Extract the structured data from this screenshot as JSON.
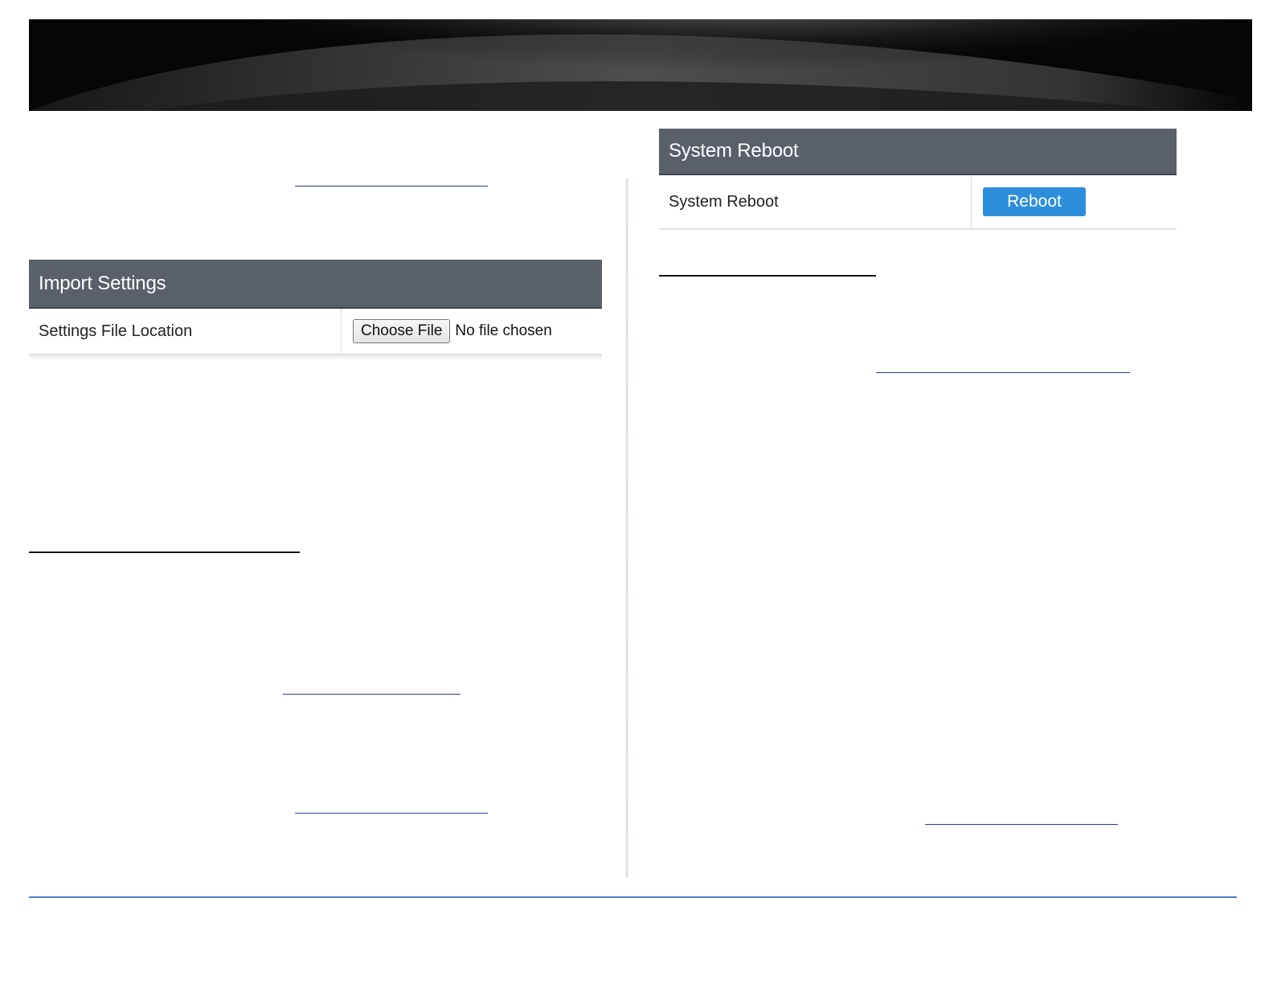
{
  "import_settings": {
    "title": "Import Settings",
    "row_label": "Settings File Location",
    "choose_file_label": "Choose File",
    "file_status": "No file chosen"
  },
  "system_reboot": {
    "title": "System Reboot",
    "row_label": "System Reboot",
    "reboot_label": "Reboot",
    "button_color": "#2d8fdc"
  },
  "colors": {
    "panel_header": "#5a6069",
    "link_underline": "#2a3b9a",
    "footer_line": "#4a7fbf"
  }
}
